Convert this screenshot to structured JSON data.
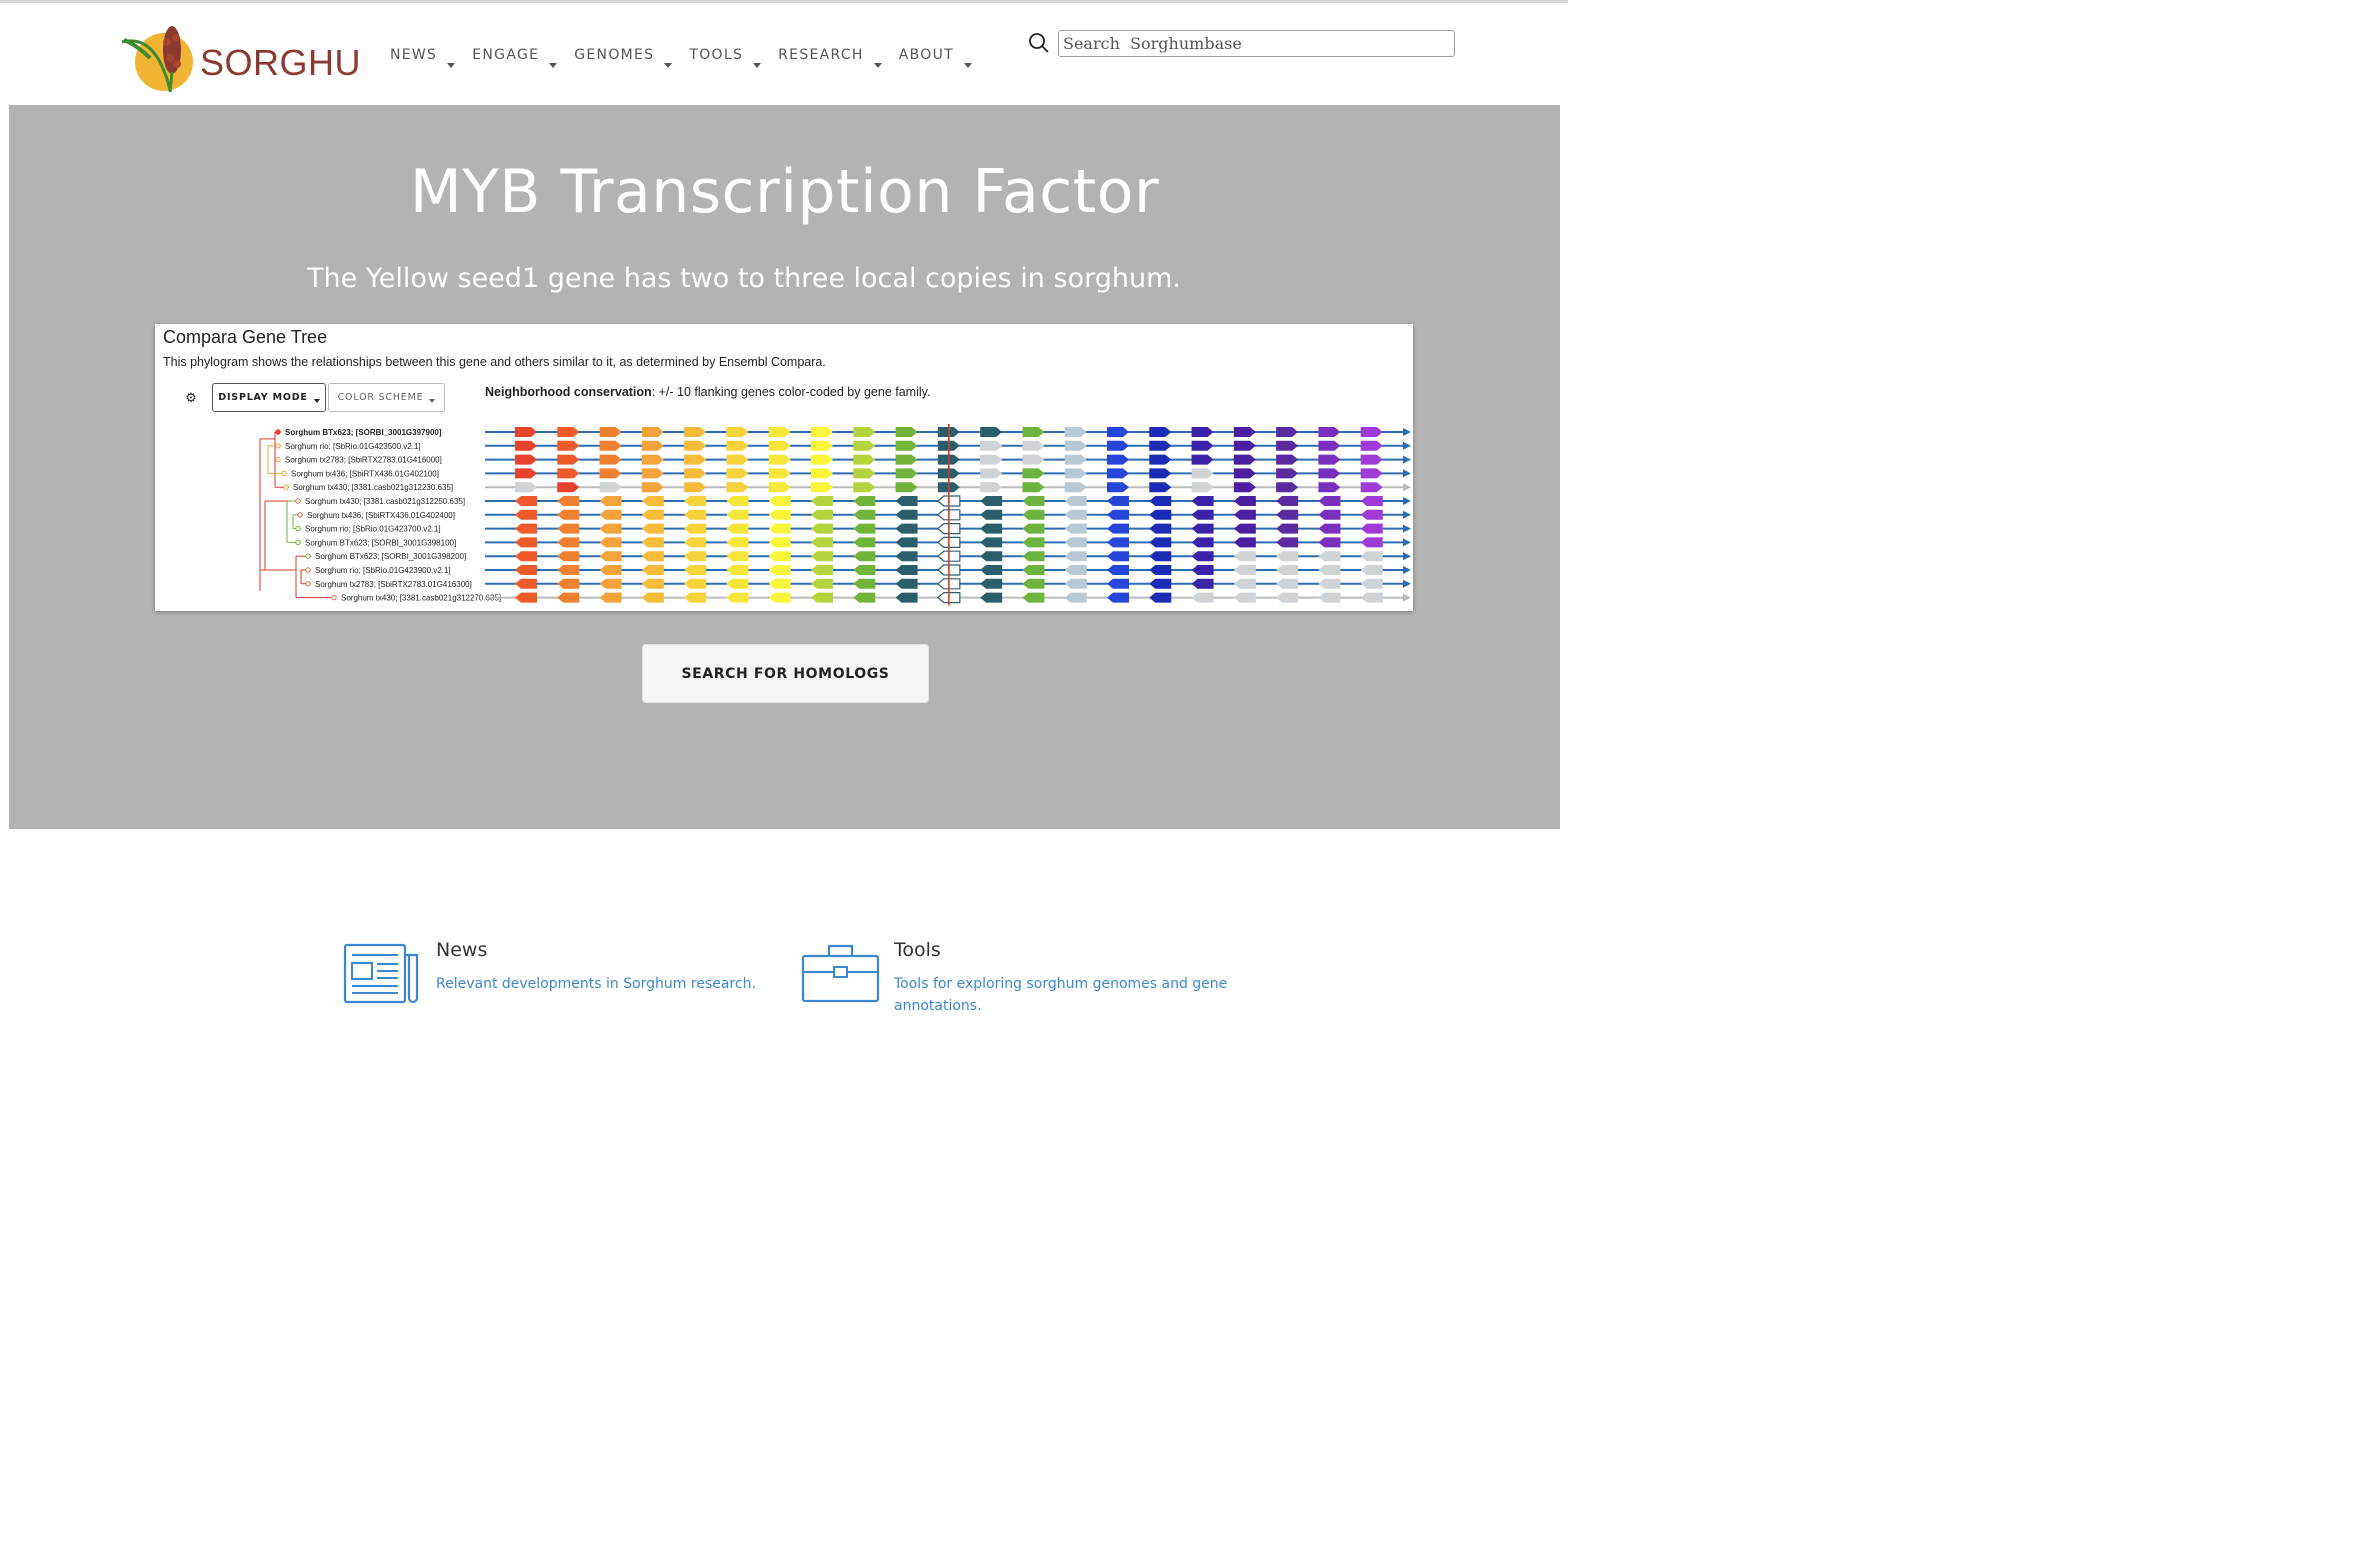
{
  "header": {
    "logo_text": "SORGHUM",
    "nav": [
      {
        "label": "NEWS"
      },
      {
        "label": "ENGAGE"
      },
      {
        "label": "GENOMES"
      },
      {
        "label": "TOOLS"
      },
      {
        "label": "RESEARCH"
      },
      {
        "label": "ABOUT"
      }
    ],
    "search_placeholder": "Search  Sorghumbase"
  },
  "hero": {
    "title": "MYB Transcription Factor",
    "subtitle": "The Yellow seed1 gene has two to three local copies in sorghum.",
    "panel": {
      "title": "Compara Gene Tree",
      "description": "This phylogram shows the relationships between this gene and others similar to it, as determined by Ensembl Compara.",
      "display_mode_label": "DISPLAY MODE",
      "color_scheme_label": "COLOR SCHEME",
      "neighborhood_label": "Neighborhood conservation",
      "neighborhood_text": ": +/- 10 flanking genes color-coded by gene family.",
      "genes": [
        "Sorghum BTx623; [SORBI_3001G397900]",
        "Sorghum rio; [SbRio.01G423500.v2.1]",
        "Sorghum tx2783; [SbiRTX2783.01G416000]",
        "Sorghum tx436; [SbiRTX436.01G402100]",
        "Sorghum tx430; [3381.casb021g312230.635]",
        "Sorghum tx430; [3381.casb021g312250.635]",
        "Sorghum tx436; [SbiRTX436.01G402400]",
        "Sorghum rio; [SbRio.01G423700.v2.1]",
        "Sorghum BTx623; [SORBI_3001G398100]",
        "Sorghum BTx623; [SORBI_3001G398200]",
        "Sorghum rio; [SbRio.01G423900.v2.1]",
        "Sorghum tx2783; [SbiRTX2783.01G416300]",
        "Sorghum tx430; [3381.casb021g312270.635]"
      ],
      "family_colors": [
        "#e8412c",
        "#ef5a2a",
        "#f07f30",
        "#f4a23a",
        "#f7bb3a",
        "#f7d23a",
        "#f7e63a",
        "#f9f53a",
        "#b5d33c",
        "#72b33a",
        "#2a5e6b",
        "#6cb33f",
        "#b9c9d3",
        "#2646d9",
        "#1b2bb5",
        "#3c22a8",
        "#4c1f9e",
        "#5b2a9e",
        "#7b2fbf",
        "#a03ad6"
      ],
      "grey_color": "#cfd3d6",
      "dark_color": "#333333"
    },
    "button_label": "SEARCH FOR HOMOLOGS"
  },
  "features": [
    {
      "icon": "newspaper-icon",
      "title": "News",
      "text": "Relevant developments in Sorghum research."
    },
    {
      "icon": "toolbox-icon",
      "title": "Tools",
      "text": "Tools for exploring sorghum genomes and gene annotations."
    }
  ]
}
